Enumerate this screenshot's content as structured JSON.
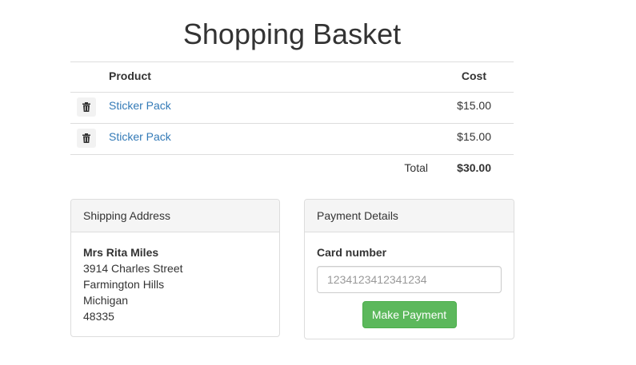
{
  "page": {
    "title": "Shopping Basket"
  },
  "basket": {
    "columns": {
      "product": "Product",
      "cost": "Cost"
    },
    "items": [
      {
        "product": "Sticker Pack",
        "cost": "$15.00",
        "remove_icon": "trash-icon"
      },
      {
        "product": "Sticker Pack",
        "cost": "$15.00",
        "remove_icon": "trash-icon"
      }
    ],
    "total_label": "Total",
    "total_value": "$30.00"
  },
  "shipping": {
    "heading": "Shipping Address",
    "name": "Mrs Rita Miles",
    "street": "3914 Charles Street",
    "city": "Farmington Hills",
    "state": "Michigan",
    "zip": "48335"
  },
  "payment": {
    "heading": "Payment Details",
    "card_label": "Card number",
    "card_placeholder": "1234123412341234",
    "card_value": "",
    "submit_label": "Make Payment"
  },
  "colors": {
    "link": "#337ab7",
    "success": "#5cb85c",
    "panel_heading_bg": "#f5f5f5"
  }
}
